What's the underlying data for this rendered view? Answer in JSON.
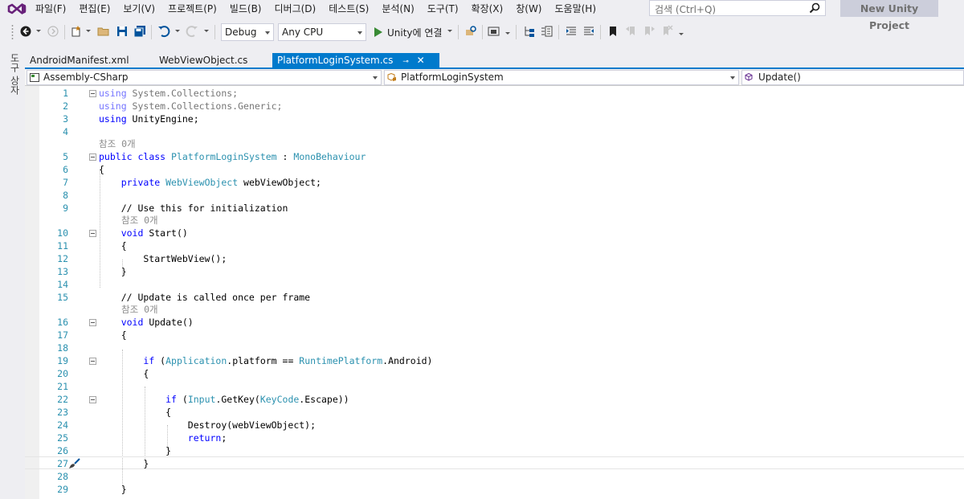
{
  "menu": {
    "items": [
      "파일(F)",
      "편집(E)",
      "보기(V)",
      "프로젝트(P)",
      "빌드(B)",
      "디버그(D)",
      "테스트(S)",
      "분석(N)",
      "도구(T)",
      "확장(X)",
      "창(W)",
      "도움말(H)"
    ],
    "search_placeholder": "검색 (Ctrl+Q)",
    "project_name": "New Unity Project"
  },
  "toolbar": {
    "configuration": "Debug",
    "platform": "Any CPU",
    "run_label": "Unity에 연결"
  },
  "side_panel": {
    "label": "도구 상자"
  },
  "tabs": [
    {
      "label": "AndroidManifest.xml",
      "active": false
    },
    {
      "label": "WebViewObject.cs",
      "active": false
    },
    {
      "label": "PlatformLoginSystem.cs",
      "active": true
    }
  ],
  "navbar": {
    "project": "Assembly-CSharp",
    "type": "PlatformLoginSystem",
    "member": "Update()"
  },
  "editor": {
    "references_label": "참조 0개",
    "lines": [
      "using System.Collections;",
      "using System.Collections.Generic;",
      "using UnityEngine;",
      "",
      "public class PlatformLoginSystem : MonoBehaviour",
      "{",
      "    private WebViewObject webViewObject;",
      "",
      "    // Use this for initialization",
      "    void Start()",
      "    {",
      "        StartWebView();",
      "    }",
      "",
      "    // Update is called once per frame",
      "    void Update()",
      "    {",
      "",
      "        if (Application.platform == RuntimePlatform.Android)",
      "        {",
      "",
      "            if (Input.GetKey(KeyCode.Escape))",
      "            {",
      "                Destroy(webViewObject);",
      "                return;",
      "            }",
      "        }",
      "",
      "    }"
    ],
    "line_numbers": [
      "1",
      "2",
      "3",
      "4",
      "5",
      "6",
      "7",
      "8",
      "9",
      "10",
      "11",
      "12",
      "13",
      "14",
      "15",
      "16",
      "17",
      "18",
      "19",
      "20",
      "21",
      "22",
      "23",
      "24",
      "25",
      "26",
      "27",
      "28",
      "29"
    ]
  }
}
